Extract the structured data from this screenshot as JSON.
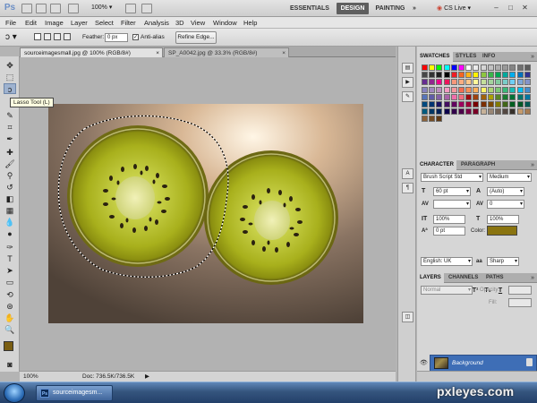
{
  "app": {
    "logo": "Ps",
    "zoom": "100%",
    "workspaces": [
      "ESSENTIALS",
      "DESIGN",
      "PAINTING"
    ],
    "active_workspace": "DESIGN",
    "more_workspaces": "»",
    "cs_live": "CS Live",
    "window_controls": [
      "–",
      "□",
      "✕"
    ]
  },
  "menubar": [
    "File",
    "Edit",
    "Image",
    "Layer",
    "Select",
    "Filter",
    "Analysis",
    "3D",
    "View",
    "Window",
    "Help"
  ],
  "options": {
    "feather_label": "Feather:",
    "feather_value": "0 px",
    "antialias_label": "Anti-alias",
    "refine_edge": "Refine Edge..."
  },
  "tabs": [
    {
      "label": "sourceimagesmall.jpg @ 100% (RGB/8#)",
      "close": "×"
    },
    {
      "label": "SP_A0042.jpg @ 33.3% (RGB/8#)",
      "close": "×"
    }
  ],
  "tooltip": "Lasso Tool (L)",
  "tools": [
    {
      "name": "move-tool",
      "glyph": "✥"
    },
    {
      "name": "marquee-tool",
      "glyph": "⬚"
    },
    {
      "name": "lasso-tool",
      "glyph": "ↄ"
    },
    {
      "name": "quick-select-tool",
      "glyph": "✎"
    },
    {
      "name": "crop-tool",
      "glyph": "⌗"
    },
    {
      "name": "eyedropper-tool",
      "glyph": "✒"
    },
    {
      "name": "healing-brush-tool",
      "glyph": "✚"
    },
    {
      "name": "brush-tool",
      "glyph": "🖌"
    },
    {
      "name": "clone-stamp-tool",
      "glyph": "⚲"
    },
    {
      "name": "history-brush-tool",
      "glyph": "↺"
    },
    {
      "name": "eraser-tool",
      "glyph": "◧"
    },
    {
      "name": "gradient-tool",
      "glyph": "▦"
    },
    {
      "name": "blur-tool",
      "glyph": "💧"
    },
    {
      "name": "dodge-tool",
      "glyph": "●"
    },
    {
      "name": "pen-tool",
      "glyph": "✑"
    },
    {
      "name": "type-tool",
      "glyph": "T"
    },
    {
      "name": "path-selection-tool",
      "glyph": "➤"
    },
    {
      "name": "shape-tool",
      "glyph": "▭"
    },
    {
      "name": "3d-rotate-tool",
      "glyph": "⟲"
    },
    {
      "name": "3d-orbit-tool",
      "glyph": "⊛"
    },
    {
      "name": "hand-tool",
      "glyph": "✋"
    },
    {
      "name": "zoom-tool",
      "glyph": "🔍"
    }
  ],
  "colors": {
    "foreground": "#7a5e12",
    "background": "#3aa6b8",
    "font_color": "#8a7410"
  },
  "status": {
    "zoom": "100%",
    "doc": "Doc: 736.5K/736.5K"
  },
  "swatches_panel": {
    "tabs": [
      "SWATCHES",
      "STYLES",
      "INFO"
    ],
    "menu": "»",
    "colors": [
      [
        "#ff0000",
        "#ffff00",
        "#00ff00",
        "#00ffff",
        "#0000ff",
        "#ff00ff",
        "#ffffff",
        "#ebebeb",
        "#d6d6d6",
        "#c2c2c2",
        "#adadad",
        "#999999",
        "#858585",
        "#707070",
        "#5c5c5c"
      ],
      [
        "#474747",
        "#333333",
        "#1f1f1f",
        "#000000",
        "#ee1d24",
        "#f36522",
        "#fcb316",
        "#fff200",
        "#8dc63f",
        "#39b54a",
        "#00a651",
        "#00a99d",
        "#00aeef",
        "#0072bc",
        "#2e3192"
      ],
      [
        "#662d91",
        "#92278f",
        "#ec008c",
        "#ed145b",
        "#f7977a",
        "#f9ad81",
        "#fdc68a",
        "#fff79a",
        "#c4df9b",
        "#a3d39c",
        "#82ca9d",
        "#7accc8",
        "#6dcff6",
        "#7ea7d8",
        "#8493ca"
      ],
      [
        "#8882be",
        "#a187be",
        "#bc8dbf",
        "#f49ac2",
        "#f6989d",
        "#f26c4f",
        "#f68e56",
        "#fbaf5c",
        "#fff467",
        "#acd373",
        "#7cc576",
        "#3bb878",
        "#1abbb4",
        "#00bff3",
        "#448ccb"
      ],
      [
        "#5674b9",
        "#605ca8",
        "#8560a8",
        "#a864a8",
        "#f06eaa",
        "#f26d7d",
        "#9e0b0f",
        "#a0410d",
        "#a36209",
        "#aba000",
        "#598527",
        "#197b30",
        "#007236",
        "#00746b",
        "#0076a3"
      ],
      [
        "#004a80",
        "#003471",
        "#1b1464",
        "#440e62",
        "#630460",
        "#9e005d",
        "#9e0039",
        "#790000",
        "#7b2e00",
        "#7d4900",
        "#827b00",
        "#406618",
        "#005e20",
        "#005826",
        "#005952"
      ],
      [
        "#005b7f",
        "#003663",
        "#002157",
        "#0d004c",
        "#32004b",
        "#4b0049",
        "#7b0046",
        "#7a0026",
        "#c7b299",
        "#998675",
        "#736357",
        "#534741",
        "#37302a",
        "#c69c6d",
        "#a67c52"
      ],
      [
        "#8c6239",
        "#754c24",
        "#603913"
      ]
    ]
  },
  "character_panel": {
    "tabs": [
      "CHARACTER",
      "PARAGRAPH"
    ],
    "menu": "»",
    "font_family": "Brush Script Std",
    "font_style": "Medium",
    "size": "60 pt",
    "leading": "(Auto)",
    "kerning": "",
    "tracking": "0",
    "vertical_scale": "100%",
    "horizontal_scale": "100%",
    "baseline": "0 pt",
    "color_label": "Color:",
    "style_buttons": [
      "T",
      "T",
      "TT",
      "Tr",
      "T¹",
      "T₁",
      "T",
      "T̶"
    ],
    "language": "English: UK",
    "aa_label": "aa",
    "antialias": "Sharp"
  },
  "layers_panel": {
    "tabs": [
      "LAYERS",
      "CHANNELS",
      "PATHS"
    ],
    "menu": "»",
    "blend_mode": "Normal",
    "opacity_label": "Opacity:",
    "fill_label": "Fill:",
    "layer_name": "Background"
  },
  "taskbar": {
    "task_label": "sourceimagesm...",
    "task_icon": "Ps"
  },
  "watermark": "pxleyes.com"
}
